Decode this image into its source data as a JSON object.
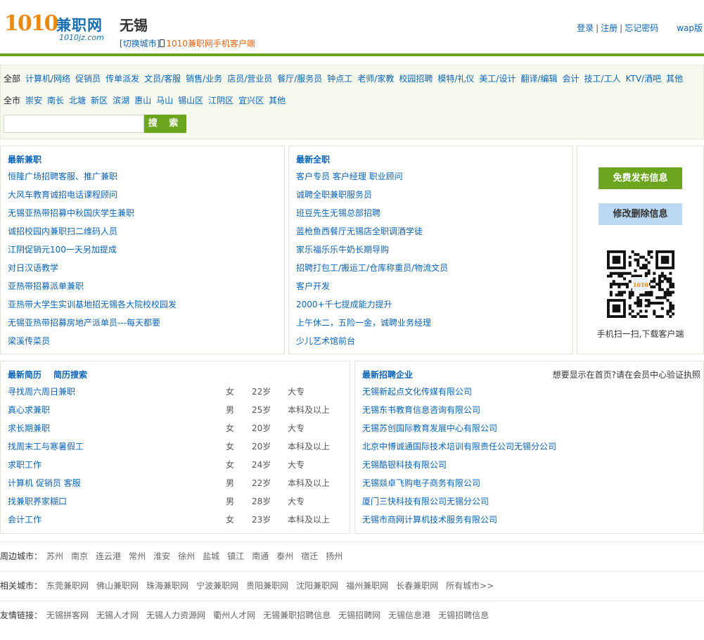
{
  "header": {
    "logo_number": "1010",
    "logo_name": "兼职网",
    "logo_domain": "1010jz.com",
    "city": "无锡",
    "switch_city": "[切换城市]",
    "app_client": "1010兼职网手机客户端",
    "login": "登录",
    "register": "注册",
    "forgot_password": "忘记密码",
    "wap": "wap版"
  },
  "filter": {
    "categories": [
      "全部",
      "计算机/网络",
      "促销员",
      "传单派发",
      "文员/客服",
      "销售/业务",
      "店员/营业员",
      "餐厅/服务员",
      "钟点工",
      "老师/家教",
      "校园招聘",
      "模特/礼仪",
      "美工/设计",
      "翻译/编辑",
      "会计",
      "技工/工人",
      "KTV/酒吧",
      "其他"
    ],
    "districts": [
      "全市",
      "崇安",
      "南长",
      "北塘",
      "新区",
      "滨湖",
      "惠山",
      "马山",
      "锡山区",
      "江阴区",
      "宜兴区",
      "其他"
    ],
    "search_placeholder": "",
    "search_button": "搜 索"
  },
  "latest_part_time": {
    "title": "最新兼职",
    "items": [
      "恒隆广场招聘客服、推广兼职",
      "大风车教育诚招电话课程顾问",
      "无锡亚热带招募中秋国庆学生兼职",
      "诚招校园内兼职扫二维码人员",
      "江阴促销元100一天另加提成",
      "对日汉语教学",
      "亚热带招募派单兼职",
      "亚热带大学生实训基地招无锡各大院校校园发",
      "无锡亚热带招募房地产派单员---每天都要",
      "梁溪传菜员"
    ]
  },
  "latest_full_time": {
    "title": "最新全职",
    "items": [
      "客户专员 客户经理 职业顾问",
      "诚聘全职兼职服务员",
      "班豆先生无锡总部招聘",
      "蓝枪鱼西餐厅无锡店全职调酒学徒",
      "家乐福乐乐牛奶长期导购",
      "招聘打包工/搬运工/仓库称重员/物流文员",
      "客户开发",
      "2000+千七提成能力提升",
      "上午休二，五险一金，诚聘业务经理",
      "少儿艺术馆前台"
    ]
  },
  "side": {
    "publish": "免费发布信息",
    "edit": "修改删除信息",
    "qr_badge": "1010",
    "qr_caption": "手机扫一扫,下载客户端"
  },
  "resumes": {
    "title": "最新简历",
    "search": "简历搜索",
    "rows": [
      {
        "title": "寻找周六周日兼职",
        "gender": "女",
        "age": "22岁",
        "edu": "大专"
      },
      {
        "title": "真心求兼职",
        "gender": "男",
        "age": "25岁",
        "edu": "本科及以上"
      },
      {
        "title": "求长期兼职",
        "gender": "女",
        "age": "20岁",
        "edu": "大专"
      },
      {
        "title": "找周末工与寒暑假工",
        "gender": "女",
        "age": "20岁",
        "edu": "本科及以上"
      },
      {
        "title": "求职工作",
        "gender": "女",
        "age": "24岁",
        "edu": "大专"
      },
      {
        "title": "计算机 促销员 客服",
        "gender": "男",
        "age": "22岁",
        "edu": "本科及以上"
      },
      {
        "title": "找兼职养家糊口",
        "gender": "男",
        "age": "28岁",
        "edu": "大专"
      },
      {
        "title": "会计工作",
        "gender": "女",
        "age": "23岁",
        "edu": "本科及以上"
      }
    ]
  },
  "companies": {
    "title": "最新招聘企业",
    "note": "想要显示在首页?请在会员中心验证执照",
    "items": [
      "无锡新起点文化传媒有限公司",
      "无锡东书教育信息咨询有限公司",
      "无锡苏创国际教育发展中心有限公司",
      "北京中博诚通国际技术培训有限责任公司无锡分公司",
      "无锡酷银科技有限公司",
      "无锡燚卓飞购电子商务有限公司",
      "厦门三快科技有限公司无锡分公司",
      "无锡市商网计算机技术服务有限公司"
    ]
  },
  "footer": {
    "nearby_label": "周边城市：",
    "nearby": [
      "苏州",
      "南京",
      "连云港",
      "常州",
      "淮安",
      "徐州",
      "盐城",
      "镇江",
      "南通",
      "泰州",
      "宿迁",
      "扬州"
    ],
    "related_label": "相关城市：",
    "related": [
      "东莞兼职网",
      "佛山兼职网",
      "珠海兼职网",
      "宁波兼职网",
      "贵阳兼职网",
      "沈阳兼职网",
      "福州兼职网",
      "长春兼职网",
      "所有城市>>"
    ],
    "friends_label": "友情链接：",
    "friends": [
      "无锡拼客网",
      "无锡人才网",
      "无锡人力资源网",
      "衢州人才网",
      "无锡兼职招聘信息",
      "无锡招聘网",
      "无锡信息港",
      "无锡招聘信息"
    ]
  }
}
